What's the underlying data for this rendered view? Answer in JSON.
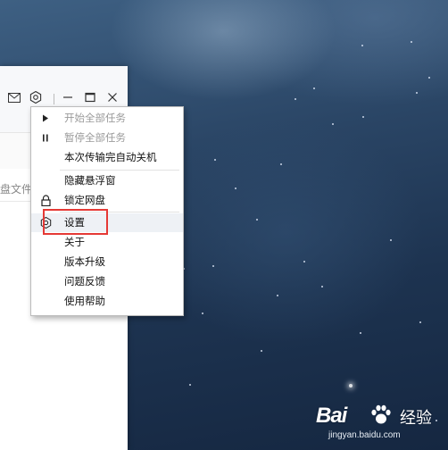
{
  "window": {
    "title_bar_icons": [
      "mail-icon",
      "gear-icon",
      "minimize-icon",
      "maximize-icon",
      "close-icon"
    ],
    "search_hint": "盘文件"
  },
  "context_menu": {
    "items": [
      {
        "label": "开始全部任务",
        "state": "disabled",
        "icon": "play-icon"
      },
      {
        "label": "暂停全部任务",
        "state": "disabled",
        "icon": "pause-icon"
      },
      {
        "label": "本次传输完自动关机",
        "state": "enabled",
        "icon": ""
      },
      {
        "label": "隐藏悬浮窗",
        "state": "enabled",
        "icon": ""
      },
      {
        "label": "锁定网盘",
        "state": "enabled",
        "icon": "lock-icon"
      },
      {
        "label": "设置",
        "state": "hover",
        "icon": "gear-icon"
      },
      {
        "label": "关于",
        "state": "enabled",
        "icon": ""
      },
      {
        "label": "版本升级",
        "state": "enabled",
        "icon": ""
      },
      {
        "label": "问题反馈",
        "state": "enabled",
        "icon": ""
      },
      {
        "label": "使用帮助",
        "state": "enabled",
        "icon": ""
      }
    ],
    "highlighted_item": "设置",
    "highlight_color": "#e53935"
  },
  "watermark": {
    "brand": "Bai",
    "product": "经验",
    "url": "jingyan.baidu.com"
  },
  "colors": {
    "menu_hover": "#eef1f5",
    "disabled_text": "#9a9a9a"
  }
}
